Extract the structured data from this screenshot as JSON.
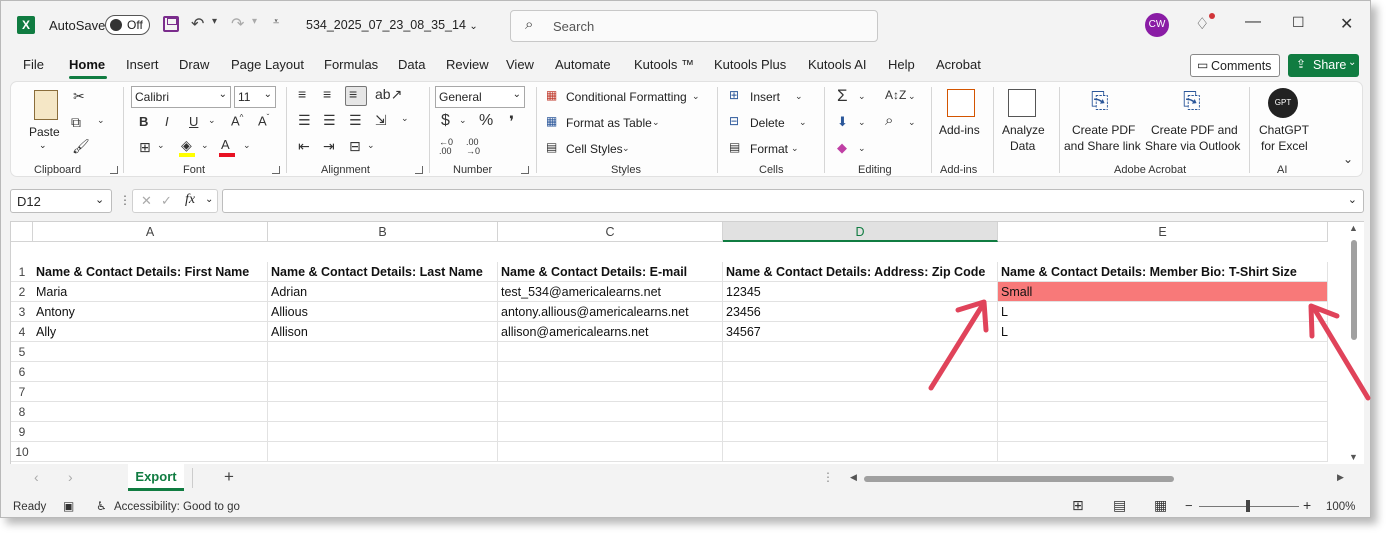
{
  "titlebar": {
    "app_letter": "X",
    "autosave_label": "AutoSave",
    "autosave_state": "Off",
    "filename": "534_2025_07_23_08_35_14",
    "search_placeholder": "Search",
    "avatar_initials": "CW"
  },
  "menu": {
    "tabs": [
      "File",
      "Home",
      "Insert",
      "Draw",
      "Page Layout",
      "Formulas",
      "Data",
      "Review",
      "View",
      "Automate",
      "Kutools ™",
      "Kutools Plus",
      "Kutools AI",
      "Help",
      "Acrobat"
    ],
    "active": "Home",
    "comments_label": "Comments",
    "share_label": "Share"
  },
  "ribbon": {
    "clipboard": {
      "label": "Clipboard",
      "paste": "Paste"
    },
    "font": {
      "label": "Font",
      "name": "Calibri",
      "size": "11"
    },
    "alignment": {
      "label": "Alignment"
    },
    "number": {
      "label": "Number",
      "format": "General"
    },
    "styles": {
      "label": "Styles",
      "conditional": "Conditional Formatting",
      "format_table": "Format as Table",
      "cell_styles": "Cell Styles"
    },
    "cells": {
      "label": "Cells",
      "insert": "Insert",
      "delete": "Delete",
      "format": "Format"
    },
    "editing": {
      "label": "Editing"
    },
    "addins": {
      "label": "Add-ins",
      "button": "Add-ins"
    },
    "analyze": {
      "line1": "Analyze",
      "line2": "Data"
    },
    "acrobat": {
      "label": "Adobe Acrobat",
      "pdf_share_l1": "Create PDF",
      "pdf_share_l2": "and Share link",
      "pdf_outlook_l1": "Create PDF and",
      "pdf_outlook_l2": "Share via Outlook"
    },
    "ai": {
      "label": "AI",
      "gpt_l1": "ChatGPT",
      "gpt_l2": "for Excel",
      "gpt_badge": "GPT"
    }
  },
  "formula_bar": {
    "name_box": "D12",
    "fx": "fx",
    "content": ""
  },
  "sheet": {
    "columns": [
      "A",
      "B",
      "C",
      "D",
      "E"
    ],
    "selected_column": "D",
    "row_numbers": [
      "1",
      "2",
      "3",
      "4",
      "5",
      "6",
      "7",
      "8",
      "9",
      "10"
    ],
    "header_row": [
      "Name & Contact Details: First Name",
      "Name & Contact Details: Last Name",
      "Name & Contact Details: E-mail",
      "Name & Contact Details: Address: Zip Code",
      "Name & Contact Details: Member Bio: T-Shirt Size"
    ],
    "rows": [
      [
        "Maria",
        "Adrian",
        "test_534@americalearns.net",
        "12345",
        "Small"
      ],
      [
        "Antony",
        "Allious",
        "antony.allious@americalearns.net",
        "23456",
        " L"
      ],
      [
        "Ally",
        "Allison",
        "allison@americalearns.net",
        "34567",
        " L"
      ]
    ],
    "highlight_color": "#f87979"
  },
  "tabs": {
    "sheet_name": "Export",
    "add": "+"
  },
  "status": {
    "ready": "Ready",
    "accessibility": "Accessibility: Good to go",
    "zoom": "100%"
  },
  "colors": {
    "excel_green": "#107c41",
    "arrow": "#e0435a"
  }
}
